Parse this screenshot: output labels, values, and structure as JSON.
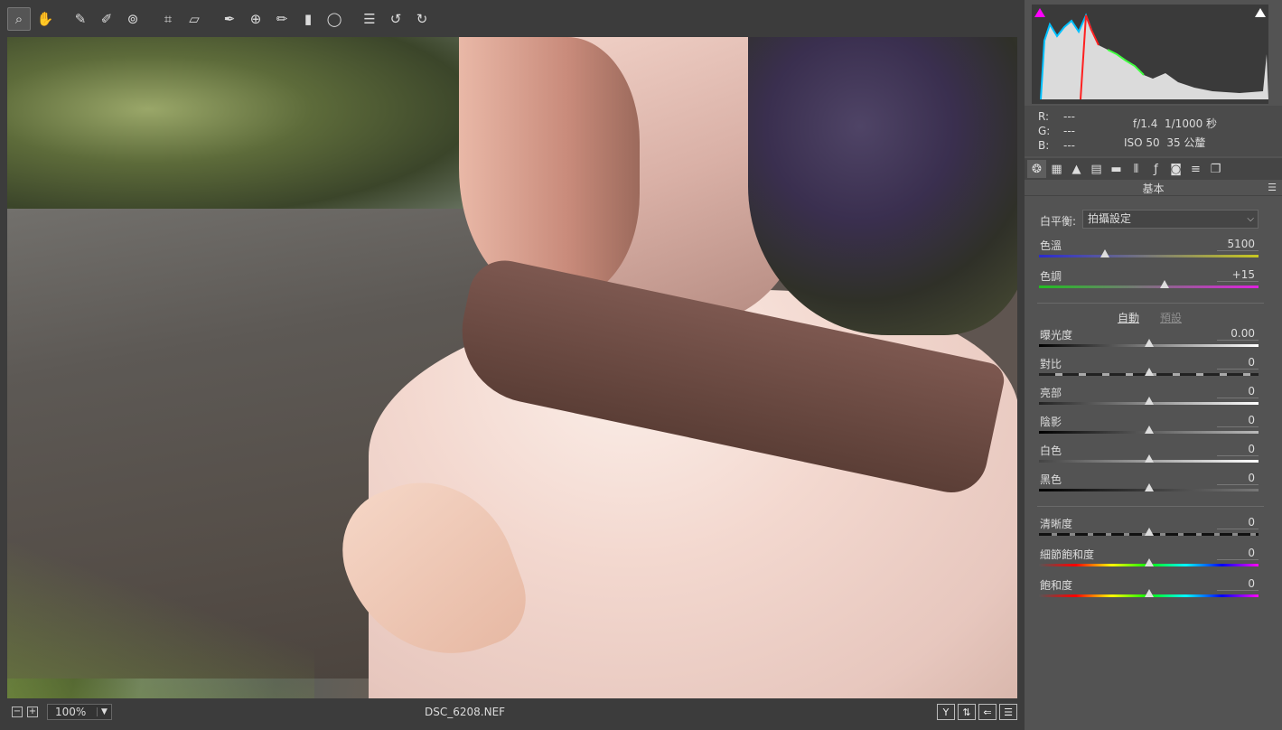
{
  "tools": [
    {
      "name": "zoom-tool",
      "icon": "⌕"
    },
    {
      "name": "hand-tool",
      "icon": "✋"
    },
    {
      "name": "white-balance-tool",
      "icon": "✎"
    },
    {
      "name": "color-sampler-tool",
      "icon": "✐"
    },
    {
      "name": "targeted-adjustment-tool",
      "icon": "⊚"
    },
    {
      "name": "crop-tool",
      "icon": "⌗"
    },
    {
      "name": "straighten-tool",
      "icon": "⏥"
    },
    {
      "name": "spot-removal-tool",
      "icon": "✒"
    },
    {
      "name": "red-eye-tool",
      "icon": "⊕"
    },
    {
      "name": "adjustment-brush-tool",
      "icon": "✏"
    },
    {
      "name": "graduated-filter-tool",
      "icon": "▮"
    },
    {
      "name": "radial-filter-tool",
      "icon": "◯"
    },
    {
      "name": "preferences-tool",
      "icon": "☰"
    },
    {
      "name": "rotate-left-tool",
      "icon": "↺"
    },
    {
      "name": "rotate-right-tool",
      "icon": "↻"
    }
  ],
  "status": {
    "zoom": "100%",
    "filename": "DSC_6208.NEF"
  },
  "readout": {
    "r_label": "R:",
    "g_label": "G:",
    "b_label": "B:",
    "r": "---",
    "g": "---",
    "b": "---",
    "aperture": "f/1.4",
    "shutter": "1/1000 秒",
    "iso": "ISO 50",
    "focal": "35 公釐"
  },
  "panel": {
    "title": "基本",
    "wb_label": "白平衡:",
    "wb_value": "拍攝設定",
    "auto": "自動",
    "default": "預設",
    "temp": {
      "label": "色溫",
      "value": "5100",
      "level": 0.3
    },
    "tint": {
      "label": "色調",
      "value": "+15",
      "level": 0.57
    },
    "exposure": {
      "label": "曝光度",
      "value": "0.00",
      "level": 0.5
    },
    "contrast": {
      "label": "對比",
      "value": "0",
      "level": 0.5
    },
    "highlights": {
      "label": "亮部",
      "value": "0",
      "level": 0.5
    },
    "shadows": {
      "label": "陰影",
      "value": "0",
      "level": 0.5
    },
    "whites": {
      "label": "白色",
      "value": "0",
      "level": 0.5
    },
    "blacks": {
      "label": "黑色",
      "value": "0",
      "level": 0.5
    },
    "clarity": {
      "label": "清晰度",
      "value": "0",
      "level": 0.5
    },
    "vibrance": {
      "label": "細節飽和度",
      "value": "0",
      "level": 0.5
    },
    "saturation": {
      "label": "飽和度",
      "value": "0",
      "level": 0.5
    }
  },
  "colors": {
    "accent": "#ff00ff"
  }
}
